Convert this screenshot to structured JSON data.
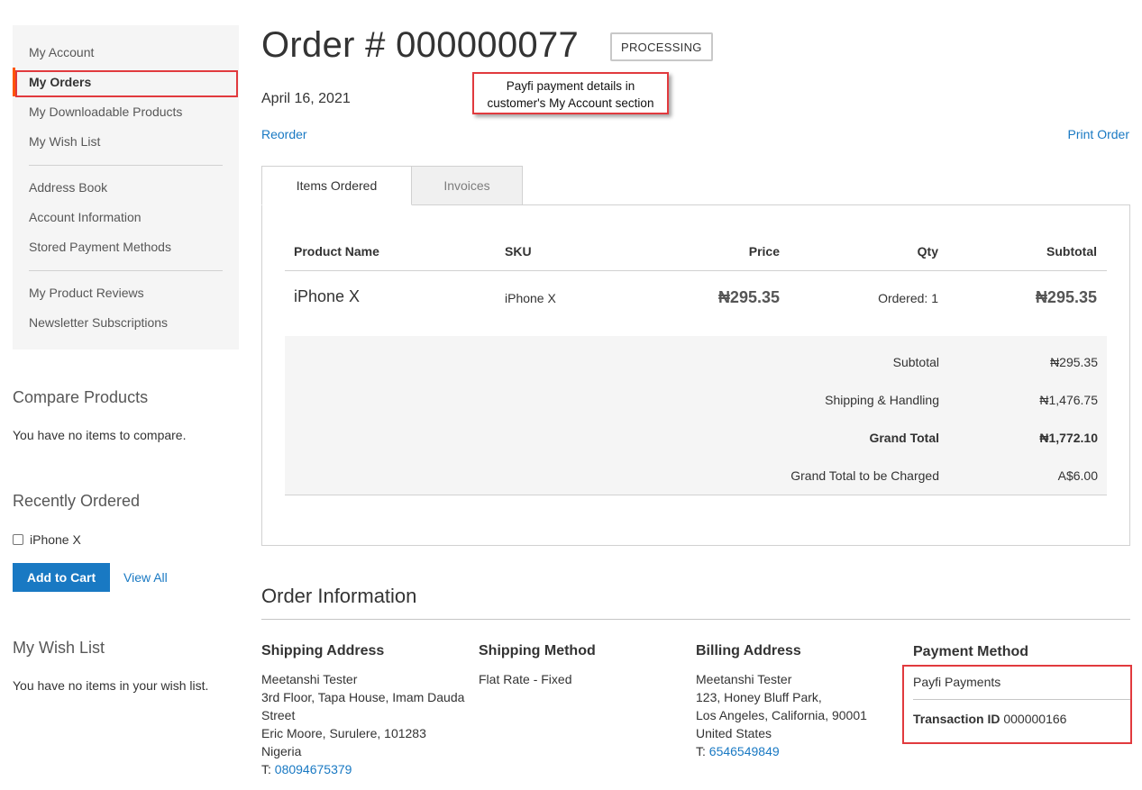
{
  "sidebar": {
    "nav": [
      {
        "label": "My Account"
      },
      {
        "label": "My Orders"
      },
      {
        "label": "My Downloadable Products"
      },
      {
        "label": "My Wish List"
      },
      {
        "label": "Address Book"
      },
      {
        "label": "Account Information"
      },
      {
        "label": "Stored Payment Methods"
      },
      {
        "label": "My Product Reviews"
      },
      {
        "label": "Newsletter Subscriptions"
      }
    ],
    "active_index": 1,
    "compare": {
      "title": "Compare Products",
      "text": "You have no items to compare."
    },
    "recently_ordered": {
      "title": "Recently Ordered",
      "item": "iPhone X",
      "add_to_cart": "Add to Cart",
      "view_all": "View All"
    },
    "wish_list": {
      "title": "My Wish List",
      "text": "You have no items in your wish list."
    }
  },
  "order": {
    "title": "Order # 000000077",
    "status": "PROCESSING",
    "date": "April 16, 2021",
    "reorder": "Reorder",
    "print": "Print Order"
  },
  "callout": {
    "line1": "Payfi payment details in",
    "line2": "customer's My Account section"
  },
  "tabs": [
    {
      "label": "Items Ordered"
    },
    {
      "label": "Invoices"
    }
  ],
  "items_table": {
    "headers": {
      "product": "Product Name",
      "sku": "SKU",
      "price": "Price",
      "qty": "Qty",
      "subtotal": "Subtotal"
    },
    "rows": [
      {
        "product": "iPhone X",
        "sku": "iPhone X",
        "price": "₦295.35",
        "qty": "Ordered: 1",
        "subtotal": "₦295.35"
      }
    ]
  },
  "totals": {
    "subtotal_label": "Subtotal",
    "subtotal_value": "₦295.35",
    "shipping_label": "Shipping & Handling",
    "shipping_value": "₦1,476.75",
    "grand_label": "Grand Total",
    "grand_value": "₦1,772.10",
    "charged_label": "Grand Total to be Charged",
    "charged_value": "A$6.00"
  },
  "order_info": {
    "title": "Order Information",
    "shipping_address": {
      "title": "Shipping Address",
      "lines": [
        "Meetanshi Tester",
        "3rd Floor, Tapa House, Imam Dauda",
        "Street",
        "Eric Moore, Surulere, 101283",
        "Nigeria"
      ],
      "phone_prefix": "T: ",
      "phone": "08094675379"
    },
    "shipping_method": {
      "title": "Shipping Method",
      "text": "Flat Rate - Fixed"
    },
    "billing_address": {
      "title": "Billing Address",
      "lines": [
        "Meetanshi Tester",
        "123, Honey Bluff Park,",
        "Los Angeles, California, 90001",
        "United States"
      ],
      "phone_prefix": "T: ",
      "phone": "6546549849"
    },
    "payment_method": {
      "title": "Payment Method",
      "name": "Payfi Payments",
      "txn_label": "Transaction ID",
      "txn_value": "000000166"
    }
  }
}
